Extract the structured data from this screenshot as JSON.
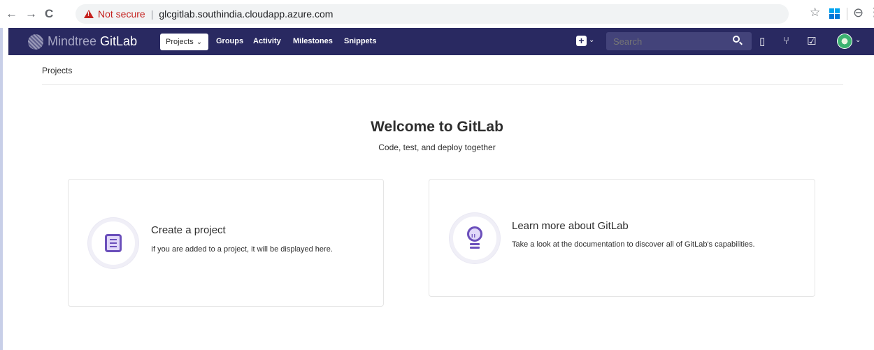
{
  "browser": {
    "back_icon": "←",
    "forward_icon": "→",
    "reload_icon": "C",
    "not_secure": "Not secure",
    "separator": "|",
    "url": "glcgitlab.southindia.cloudapp.azure.com",
    "star_icon": "☆",
    "profile_icon": "⊖",
    "menu_icon": "⋮"
  },
  "header": {
    "brand_prefix": "Mindtree",
    "brand_suffix": "GitLab",
    "nav": {
      "projects": "Projects",
      "groups": "Groups",
      "activity": "Activity",
      "milestones": "Milestones",
      "snippets": "Snippets"
    },
    "new_button": "+",
    "search_placeholder": "Search",
    "icons": [
      "issues-icon",
      "merge-requests-icon",
      "todos-icon"
    ]
  },
  "breadcrumb": "Projects",
  "welcome": {
    "title": "Welcome to GitLab",
    "subtitle": "Code, test, and deploy together"
  },
  "cards": {
    "create": {
      "title": "Create a project",
      "text": "If you are added to a project, it will be displayed here."
    },
    "learn": {
      "title": "Learn more about GitLab",
      "text": "Take a look at the documentation to discover all of GitLab's capabilities."
    }
  },
  "colors": {
    "header_bg": "#292961",
    "accent": "#6b4fbb",
    "not_secure": "#c5221f"
  }
}
